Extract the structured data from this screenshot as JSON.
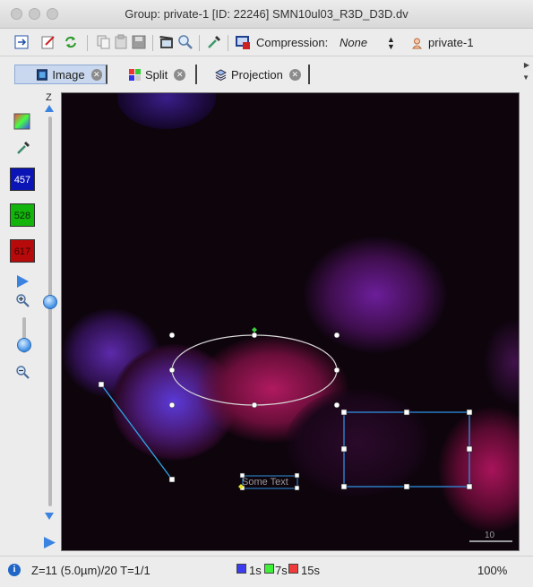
{
  "window": {
    "title": "Group: private-1 [ID: 22246] SMN10ul03_R3D_D3D.dv"
  },
  "toolbar": {
    "compression_label": "Compression:",
    "compression_value": "None",
    "user": "private-1"
  },
  "tabs": [
    {
      "label": "Image",
      "selected": true
    },
    {
      "label": "Split",
      "selected": false
    },
    {
      "label": "Projection",
      "selected": false
    }
  ],
  "channels": [
    {
      "label": "457",
      "color": "#0b14b4"
    },
    {
      "label": "528",
      "color": "#13b40b"
    },
    {
      "label": "617",
      "color": "#b70b0b"
    }
  ],
  "z_slider": {
    "label": "Z"
  },
  "viewer": {
    "scalebar_label": "10",
    "text_annotation": "Some Text"
  },
  "status": {
    "position_text": "Z=11 (5.0µm)/20 T=1/1",
    "timings": [
      {
        "label": "1s",
        "color": "#3b3bf0"
      },
      {
        "label": "7s",
        "color": "#3ff03b"
      },
      {
        "label": "15s",
        "color": "#f03b3b"
      }
    ],
    "zoom": "100%"
  }
}
